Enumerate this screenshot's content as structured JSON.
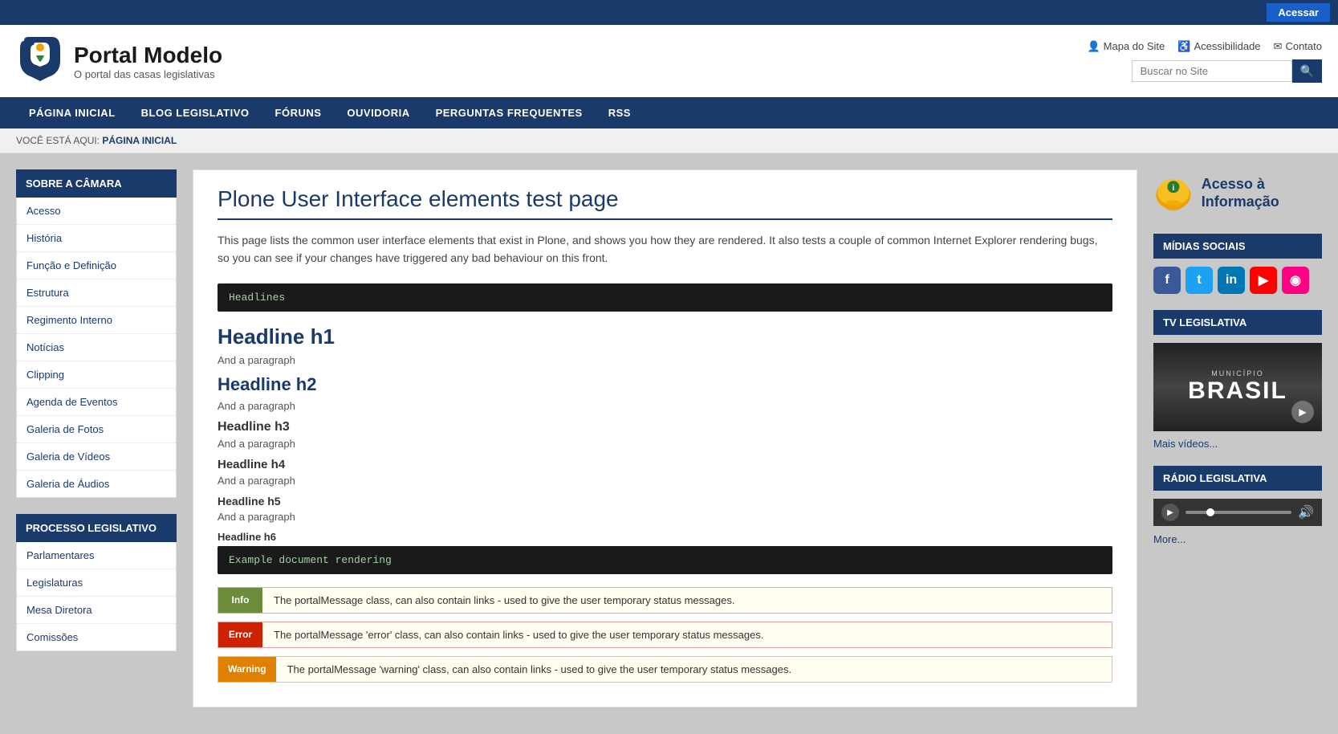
{
  "topbar": {
    "login_label": "Acessar"
  },
  "header": {
    "logo_title": "Portal Modelo",
    "logo_subtitle": "O portal das casas legislativas",
    "links": {
      "mapa": "Mapa do Site",
      "acessibilidade": "Acessibilidade",
      "contato": "Contato"
    },
    "search_placeholder": "Buscar no Site"
  },
  "nav": {
    "items": [
      "PÁGINA INICIAL",
      "BLOG LEGISLATIVO",
      "FÓRUNS",
      "OUVIDORIA",
      "PERGUNTAS FREQUENTES",
      "RSS"
    ]
  },
  "breadcrumb": {
    "prefix": "VOCÊ ESTÁ AQUI:",
    "current": "PÁGINA INICIAL"
  },
  "sidebar": {
    "section1_title": "SOBRE A CÂMARA",
    "section1_items": [
      "Acesso",
      "História",
      "Função e Definição",
      "Estrutura",
      "Regimento Interno",
      "Notícias",
      "Clipping",
      "Agenda de Eventos",
      "Galeria de Fotos",
      "Galeria de Vídeos",
      "Galeria de Áudios"
    ],
    "section2_title": "PROCESSO LEGISLATIVO",
    "section2_items": [
      "Parlamentares",
      "Legislaturas",
      "Mesa Diretora",
      "Comissões"
    ]
  },
  "content": {
    "page_title": "Plone User Interface elements test page",
    "intro": "This page lists the common user interface elements that exist in Plone, and shows you how they are rendered. It also tests a couple of common Internet Explorer rendering bugs, so you can see if your changes have triggered any bad behaviour on this front.",
    "code1": "Headlines",
    "h1_label": "Headline h1",
    "h1_para": "And a paragraph",
    "h2_label": "Headline h2",
    "h2_para": "And a paragraph",
    "h3_label": "Headline h3",
    "h3_para": "And a paragraph",
    "h4_label": "Headline h4",
    "h4_para": "And a paragraph",
    "h5_label": "Headline h5",
    "h5_para": "And a paragraph",
    "h6_label": "Headline h6",
    "code2": "Example document rendering",
    "msg_info_label": "Info",
    "msg_info_text": "The portalMessage class, can also contain links - used to give the user temporary status messages.",
    "msg_error_label": "Error",
    "msg_error_text": "The portalMessage 'error' class, can also contain links - used to give the user temporary status messages.",
    "msg_warning_label": "Warning",
    "msg_warning_text": "The portalMessage 'warning' class, can also contain links - used to give the user temporary status messages."
  },
  "right_panel": {
    "acesso_text": "Acesso à Informação",
    "midias_title": "MÍDIAS SOCIAIS",
    "social": {
      "fb": "f",
      "tw": "t",
      "li": "in",
      "yt": "▶",
      "fl": "◉"
    },
    "tv_title": "TV LEGISLATIVA",
    "video": {
      "municipio": "MUNICÍPIO",
      "brasil": "BRASIL"
    },
    "mais_videos": "Mais vídeos...",
    "radio_title": "RÁDIO LEGISLATIVA",
    "more_label": "More..."
  }
}
